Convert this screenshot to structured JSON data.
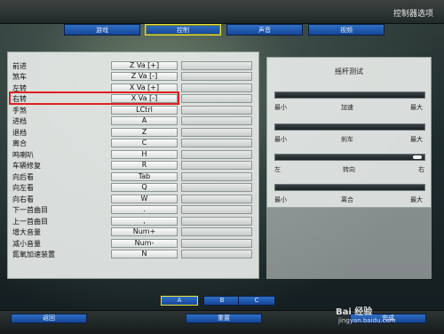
{
  "window": {
    "title": "控制器选项"
  },
  "tabs": [
    {
      "label": "游戏"
    },
    {
      "label": "控制"
    },
    {
      "label": "声音"
    },
    {
      "label": "视频"
    }
  ],
  "bindings": [
    {
      "action": "前进",
      "key": "Z Va [+]"
    },
    {
      "action": "煞车",
      "key": "Z Va [-]"
    },
    {
      "action": "左转",
      "key": "X Va [+]"
    },
    {
      "action": "右转",
      "key": "X Va [-]"
    },
    {
      "action": "手煞",
      "key": "LCtrl"
    },
    {
      "action": "进档",
      "key": "A"
    },
    {
      "action": "退档",
      "key": "Z"
    },
    {
      "action": "离合",
      "key": "C"
    },
    {
      "action": "鸣喇叭",
      "key": "H"
    },
    {
      "action": "车辆修复",
      "key": "R"
    },
    {
      "action": "向后看",
      "key": "Tab"
    },
    {
      "action": "向左看",
      "key": "Q"
    },
    {
      "action": "向右看",
      "key": "W"
    },
    {
      "action": "下一首曲目",
      "key": "."
    },
    {
      "action": "上一首曲目",
      "key": ","
    },
    {
      "action": "增大音量",
      "key": "Num+"
    },
    {
      "action": "减小音量",
      "key": "Num-"
    },
    {
      "action": "氮氧加速装置",
      "key": "N"
    }
  ],
  "joystick_test": {
    "title": "摇杆测试",
    "axes": [
      {
        "left": "最小",
        "center": "加速",
        "right": "最大"
      },
      {
        "left": "最小",
        "center": "刹车",
        "right": "最大"
      },
      {
        "left": "左",
        "center": "转向",
        "right": "右"
      },
      {
        "left": "最小",
        "center": "离合",
        "right": "最大"
      }
    ]
  },
  "controller_buttons": [
    {
      "label": "A"
    },
    {
      "label": "B"
    },
    {
      "label": "C"
    }
  ],
  "bottom": {
    "back_label": "返回",
    "reset_label": "重置",
    "done_label": "完成"
  },
  "watermark": {
    "text": "Bai 经验",
    "url": "jingyan.baidu.com"
  }
}
